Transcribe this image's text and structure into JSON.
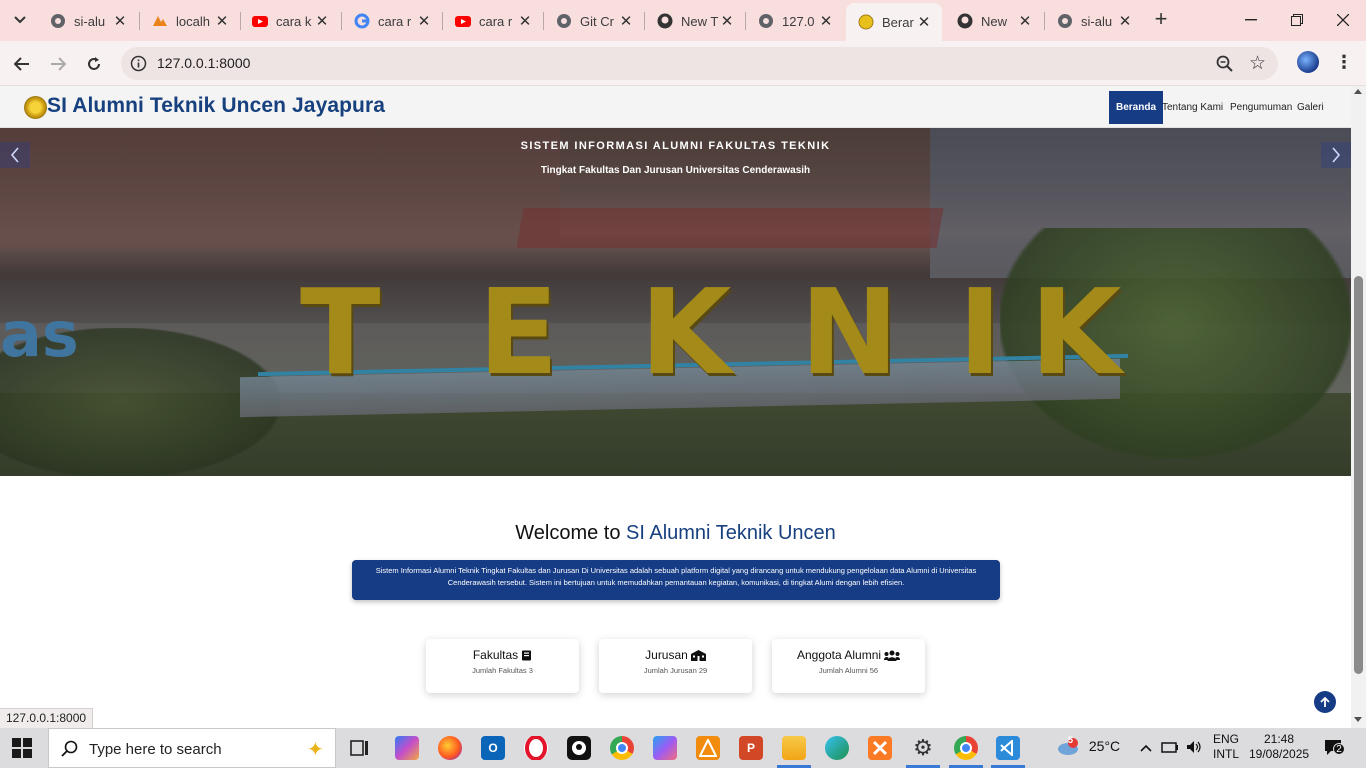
{
  "browser": {
    "tabs": [
      {
        "title": "si-alu",
        "favicon": "globe-icon"
      },
      {
        "title": "localh",
        "favicon": "phpmyadmin-icon"
      },
      {
        "title": "cara k",
        "favicon": "youtube-icon"
      },
      {
        "title": "cara r",
        "favicon": "google-icon"
      },
      {
        "title": "cara r",
        "favicon": "youtube-icon"
      },
      {
        "title": "Git Cr",
        "favicon": "globe-icon"
      },
      {
        "title": "New T",
        "favicon": "github-icon"
      },
      {
        "title": "127.0",
        "favicon": "globe-icon"
      },
      {
        "title": "Berar",
        "favicon": "uncen-logo-icon",
        "active": true
      },
      {
        "title": "New",
        "favicon": "github-icon"
      },
      {
        "title": "si-alu",
        "favicon": "globe-icon"
      }
    ],
    "url": "127.0.0.1:8000",
    "status_url": "127.0.0.1:8000"
  },
  "site": {
    "brand": "SI Alumni Teknik Uncen Jayapura",
    "nav": [
      {
        "label": "Beranda",
        "active": true
      },
      {
        "label": "Tentang Kami"
      },
      {
        "label": "Pengumuman"
      },
      {
        "label": "Galeri"
      }
    ],
    "hero": {
      "title": "SISTEM INFORMASI ALUMNI FAKULTAS TEKNIK",
      "subtitle": "Tingkat Fakultas Dan Jurusan Universitas Cenderawasih",
      "sign_letters": [
        "T",
        "E",
        "K",
        "N",
        "I",
        "K"
      ],
      "sign_fragment": "as"
    },
    "welcome": {
      "prefix": "Welcome to ",
      "highlight": "SI Alumni Teknik Uncen"
    },
    "intro": "Sistem Informasi Alumni Teknik Tingkat Fakultas dan Jurusan Di Universitas adalah sebuah platform digital yang dirancang untuk mendukung pengelolaan data Alumni di Universitas Cenderawasih tersebut. Sistem ini bertujuan untuk memudahkan pemantauan kegiatan, komunikasi, di tingkat Alumi dengan lebih efisien.",
    "stats": [
      {
        "title": "Fakultas",
        "icon": "book-icon",
        "caption": "Jumlah Fakultas 3"
      },
      {
        "title": "Jurusan",
        "icon": "school-icon",
        "caption": "Jumlah Jurusan 29"
      },
      {
        "title": "Anggota Alumni",
        "icon": "users-icon",
        "caption": "Jumlah Alumni 56"
      }
    ]
  },
  "taskbar": {
    "search_placeholder": "Type here to search",
    "weather_temp": "25°C",
    "weather_badge": "5",
    "lang_line1": "ENG",
    "lang_line2": "INTL",
    "time": "21:48",
    "date": "19/08/2025",
    "notification_count": "2"
  },
  "colors": {
    "brand_navy": "#163c86",
    "brand_text": "#17407f",
    "tabstrip": "#f9dede"
  }
}
